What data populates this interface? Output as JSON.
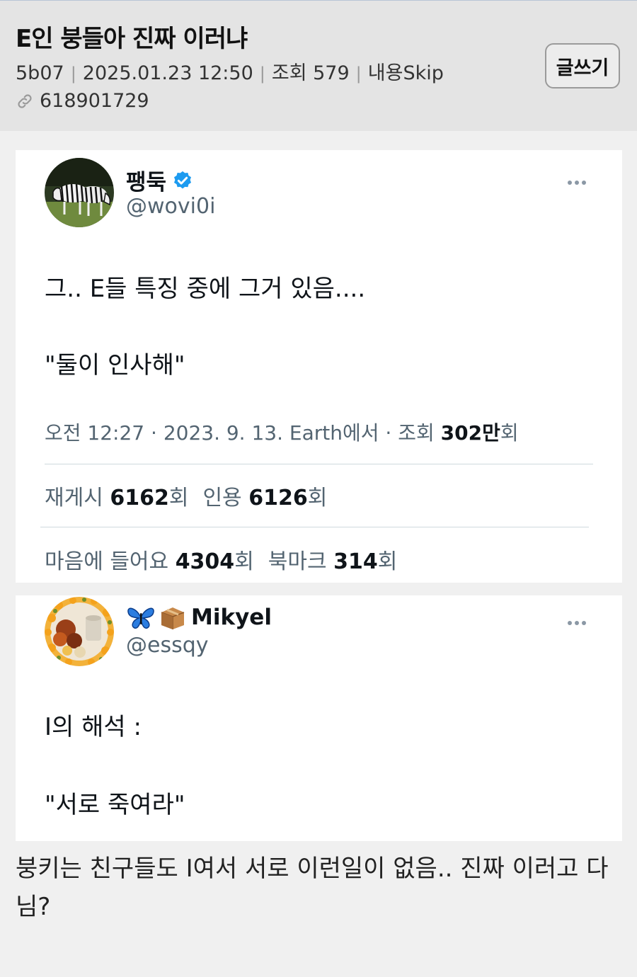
{
  "header": {
    "title": "E인 붕들아 진짜 이러냐",
    "author": "5b07",
    "datetime": "2025.01.23 12:50",
    "views": "조회 579",
    "skip": "내용Skip",
    "link_id": "618901729",
    "write_button": "글쓰기"
  },
  "tweet1": {
    "display_name": "팽둑",
    "handle": "@wovi0i",
    "avatar_icon": "zebra-photo",
    "verified_icon": "verified-badge-icon",
    "line1": "그.. E들 특징 중에 그거 있음....",
    "line2": "\"둘이 인사해\"",
    "timestamp_prefix": "오전 12:27 · 2023. 9. 13. Earth에서 · 조회 ",
    "timestamp_views": "302만",
    "timestamp_suffix": "회",
    "reposts_label": "재게시 ",
    "reposts_count": "6162",
    "reposts_unit": "회",
    "quotes_label": "인용 ",
    "quotes_count": "6126",
    "quotes_unit": "회",
    "likes_label": "마음에 들어요 ",
    "likes_count": "4304",
    "likes_unit": "회",
    "bookmarks_label": "북마크 ",
    "bookmarks_count": "314",
    "bookmarks_unit": "회"
  },
  "tweet2": {
    "display_name": "Mikyel",
    "handle": "@essqy",
    "avatar_icon": "flowers-photo",
    "name_emojis": [
      "butterfly-emoji",
      "package-emoji"
    ],
    "line1": "I의 해석 :",
    "line2": "\"서로 죽여라\""
  },
  "post_body": "붕키는 친구들도 I여서 서로 이런일이 없음.. 진짜 이러고 다님?",
  "colors": {
    "header_bg": "#e4e4e4",
    "page_bg": "#f0f0f0",
    "verified_blue": "#1d9bf0",
    "secondary_text": "#536471"
  }
}
